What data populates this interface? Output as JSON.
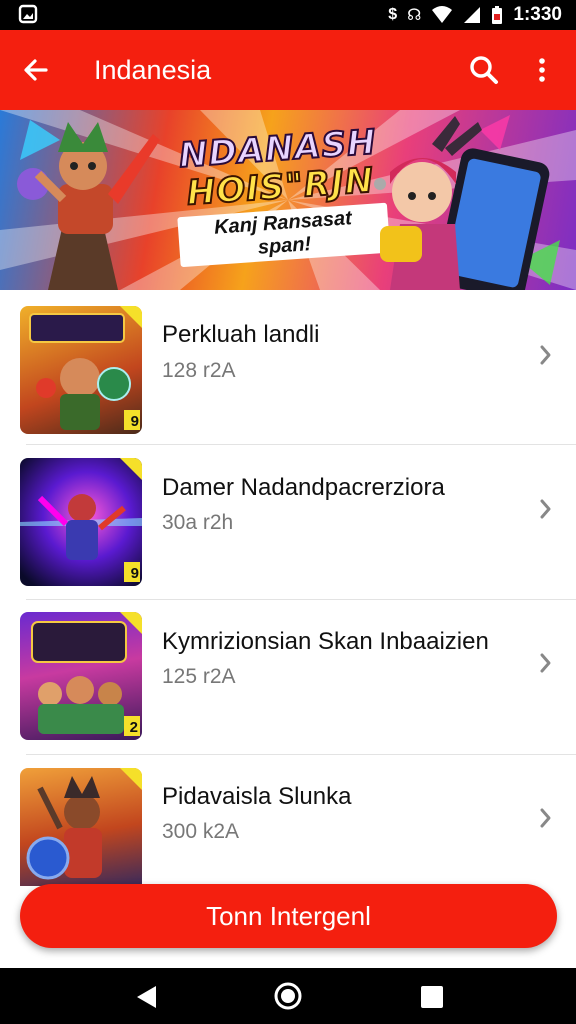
{
  "status_bar": {
    "time": "1:330",
    "icons": [
      "notification-icon",
      "data-saver-icon",
      "signal-icon",
      "wifi-icon",
      "cell-signal-icon",
      "battery-icon"
    ]
  },
  "app_bar": {
    "title": "Indanesia",
    "back_icon": "arrow-left-icon",
    "search_icon": "search-icon",
    "more_icon": "more-vert-icon"
  },
  "banner": {
    "line1": "NDANASH",
    "line2": "HOIS\"RJN",
    "tagline": "Kanj Ransasat span!"
  },
  "items": [
    {
      "title": "Perkluah landli",
      "size": "128 r2A",
      "thumb_badge": "9",
      "accent": "#f8a51c"
    },
    {
      "title": "Damer Nadandpacrerziora",
      "size": "30a r2h",
      "thumb_badge": "9",
      "accent": "#6a2ad6"
    },
    {
      "title": "Kymrizionsian Skan Inbaaizien",
      "size": "125 r2A",
      "thumb_badge": "2",
      "accent": "#b02aa8"
    },
    {
      "title": "Pidavaisla Slunka",
      "size": "300 k2A",
      "thumb_badge": "",
      "accent": "#2a5fd0"
    }
  ],
  "cta": {
    "label": "Tonn Intergenl"
  },
  "nav_bar": {
    "icons": [
      "nav-back-icon",
      "nav-home-icon",
      "nav-recents-icon"
    ]
  },
  "colors": {
    "primary": "#f41f0f",
    "text": "#111111",
    "secondary_text": "#777777"
  }
}
